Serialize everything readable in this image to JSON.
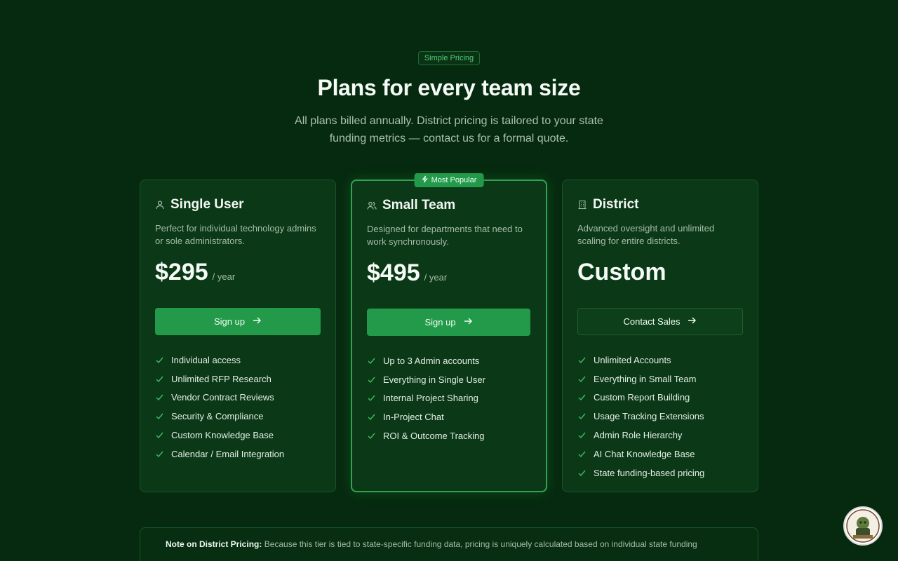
{
  "hero": {
    "badge": "Simple Pricing",
    "title": "Plans for every team size",
    "subtitle": "All plans billed annually. District pricing is tailored to your state funding metrics — contact us for a formal quote."
  },
  "plans": [
    {
      "name": "Single User",
      "icon": "user-icon",
      "description": "Perfect for individual technology admins or sole administrators.",
      "price": "$295",
      "period": "/ year",
      "cta": "Sign up",
      "features": [
        "Individual access",
        "Unlimited RFP Research",
        "Vendor Contract Reviews",
        "Security & Compliance",
        "Custom Knowledge Base",
        "Calendar / Email Integration"
      ]
    },
    {
      "name": "Small Team",
      "icon": "users-icon",
      "badge": "Most Popular",
      "description": "Designed for departments that need to work synchronously.",
      "price": "$495",
      "period": "/ year",
      "cta": "Sign up",
      "features": [
        "Up to 3 Admin accounts",
        "Everything in Single User",
        "Internal Project Sharing",
        "In-Project Chat",
        "ROI & Outcome Tracking"
      ]
    },
    {
      "name": "District",
      "icon": "building-icon",
      "description": "Advanced oversight and unlimited scaling for entire districts.",
      "price": "Custom",
      "cta": "Contact Sales",
      "features": [
        "Unlimited Accounts",
        "Everything in Small Team",
        "Custom Report Building",
        "Usage Tracking Extensions",
        "Admin Role Hierarchy",
        "AI Chat Knowledge Base",
        "State funding-based pricing"
      ]
    }
  ],
  "note": {
    "label": "Note on District Pricing:",
    "text": "Because this tier is tied to state-specific funding data, pricing is uniquely calculated based on individual state funding"
  },
  "colors": {
    "background": "#062a0f",
    "card": "#0b3817",
    "accent": "#23994a",
    "check": "#3bbf63"
  }
}
